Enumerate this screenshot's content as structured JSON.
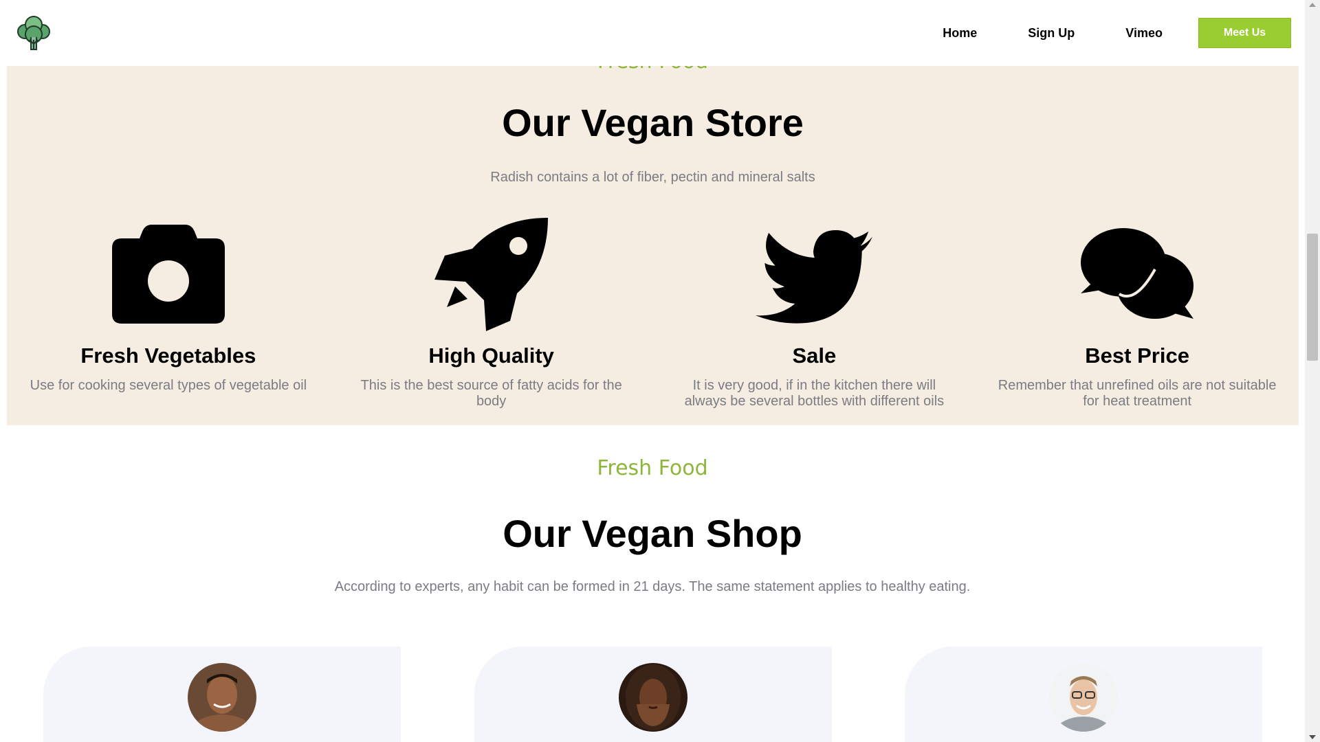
{
  "header": {
    "logo_icon": "broccoli-tree-icon",
    "nav": {
      "home": "Home",
      "signup": "Sign Up",
      "vimeo": "Vimeo",
      "meet_us": "Meet Us"
    },
    "accent_color": "#9acd32"
  },
  "store": {
    "kicker": "Fresh Food",
    "title": "Our Vegan Store",
    "subtitle": "Radish contains a lot of fiber, pectin and mineral salts",
    "background_color": "#f5ede1",
    "features": [
      {
        "icon": "camera-icon",
        "title": "Fresh Vegetables",
        "desc": "Use for cooking several types of vegetable oil"
      },
      {
        "icon": "rocket-icon",
        "title": "High Quality",
        "desc": "This is the best source of fatty acids for the body"
      },
      {
        "icon": "twitter-bird-icon",
        "title": "Sale",
        "desc": "It is very good, if in the kitchen there will always be several bottles with different oils"
      },
      {
        "icon": "chat-bubbles-icon",
        "title": "Best Price",
        "desc": "Remember that unrefined oils are not suitable for heat treatment"
      }
    ]
  },
  "shop": {
    "kicker": "Fresh Food",
    "title": "Our Vegan Shop",
    "subtitle": "According to experts, any habit can be formed in 21 days. The same statement applies to healthy eating.",
    "cards": [
      {
        "avatar": "avatar-man-smiling"
      },
      {
        "avatar": "avatar-woman-hands-on-face"
      },
      {
        "avatar": "avatar-man-glasses"
      }
    ]
  }
}
